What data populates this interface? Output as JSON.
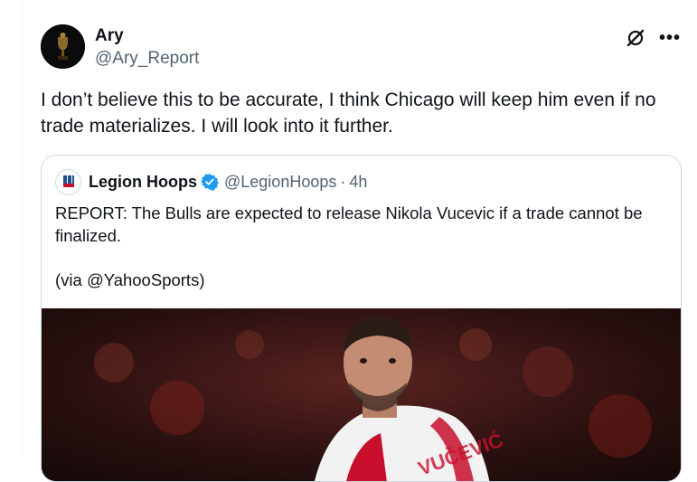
{
  "author": {
    "display_name": "Ary",
    "handle": "@Ary_Report",
    "avatar_icon": "trophy-avatar"
  },
  "actions": {
    "grok_icon": "grok-slash-icon",
    "more_label": "•••"
  },
  "tweet": {
    "text": "I don’t believe this to be accurate, I think Chicago will keep him even if no trade materializes. I will look into it further."
  },
  "quote": {
    "display_name": "Legion Hoops",
    "handle": "@LegionHoops",
    "separator": "·",
    "time": "4h",
    "text": "REPORT: The Bulls are expected to release Nikola Vucevic if a trade cannot be finalized.",
    "source": "(via @YahooSports)",
    "verified_color": "#1d9bf0",
    "media_icon": "basketball-player-photo"
  },
  "colors": {
    "text": "#0f1419",
    "secondary": "#536471",
    "border": "#cfd9de"
  }
}
